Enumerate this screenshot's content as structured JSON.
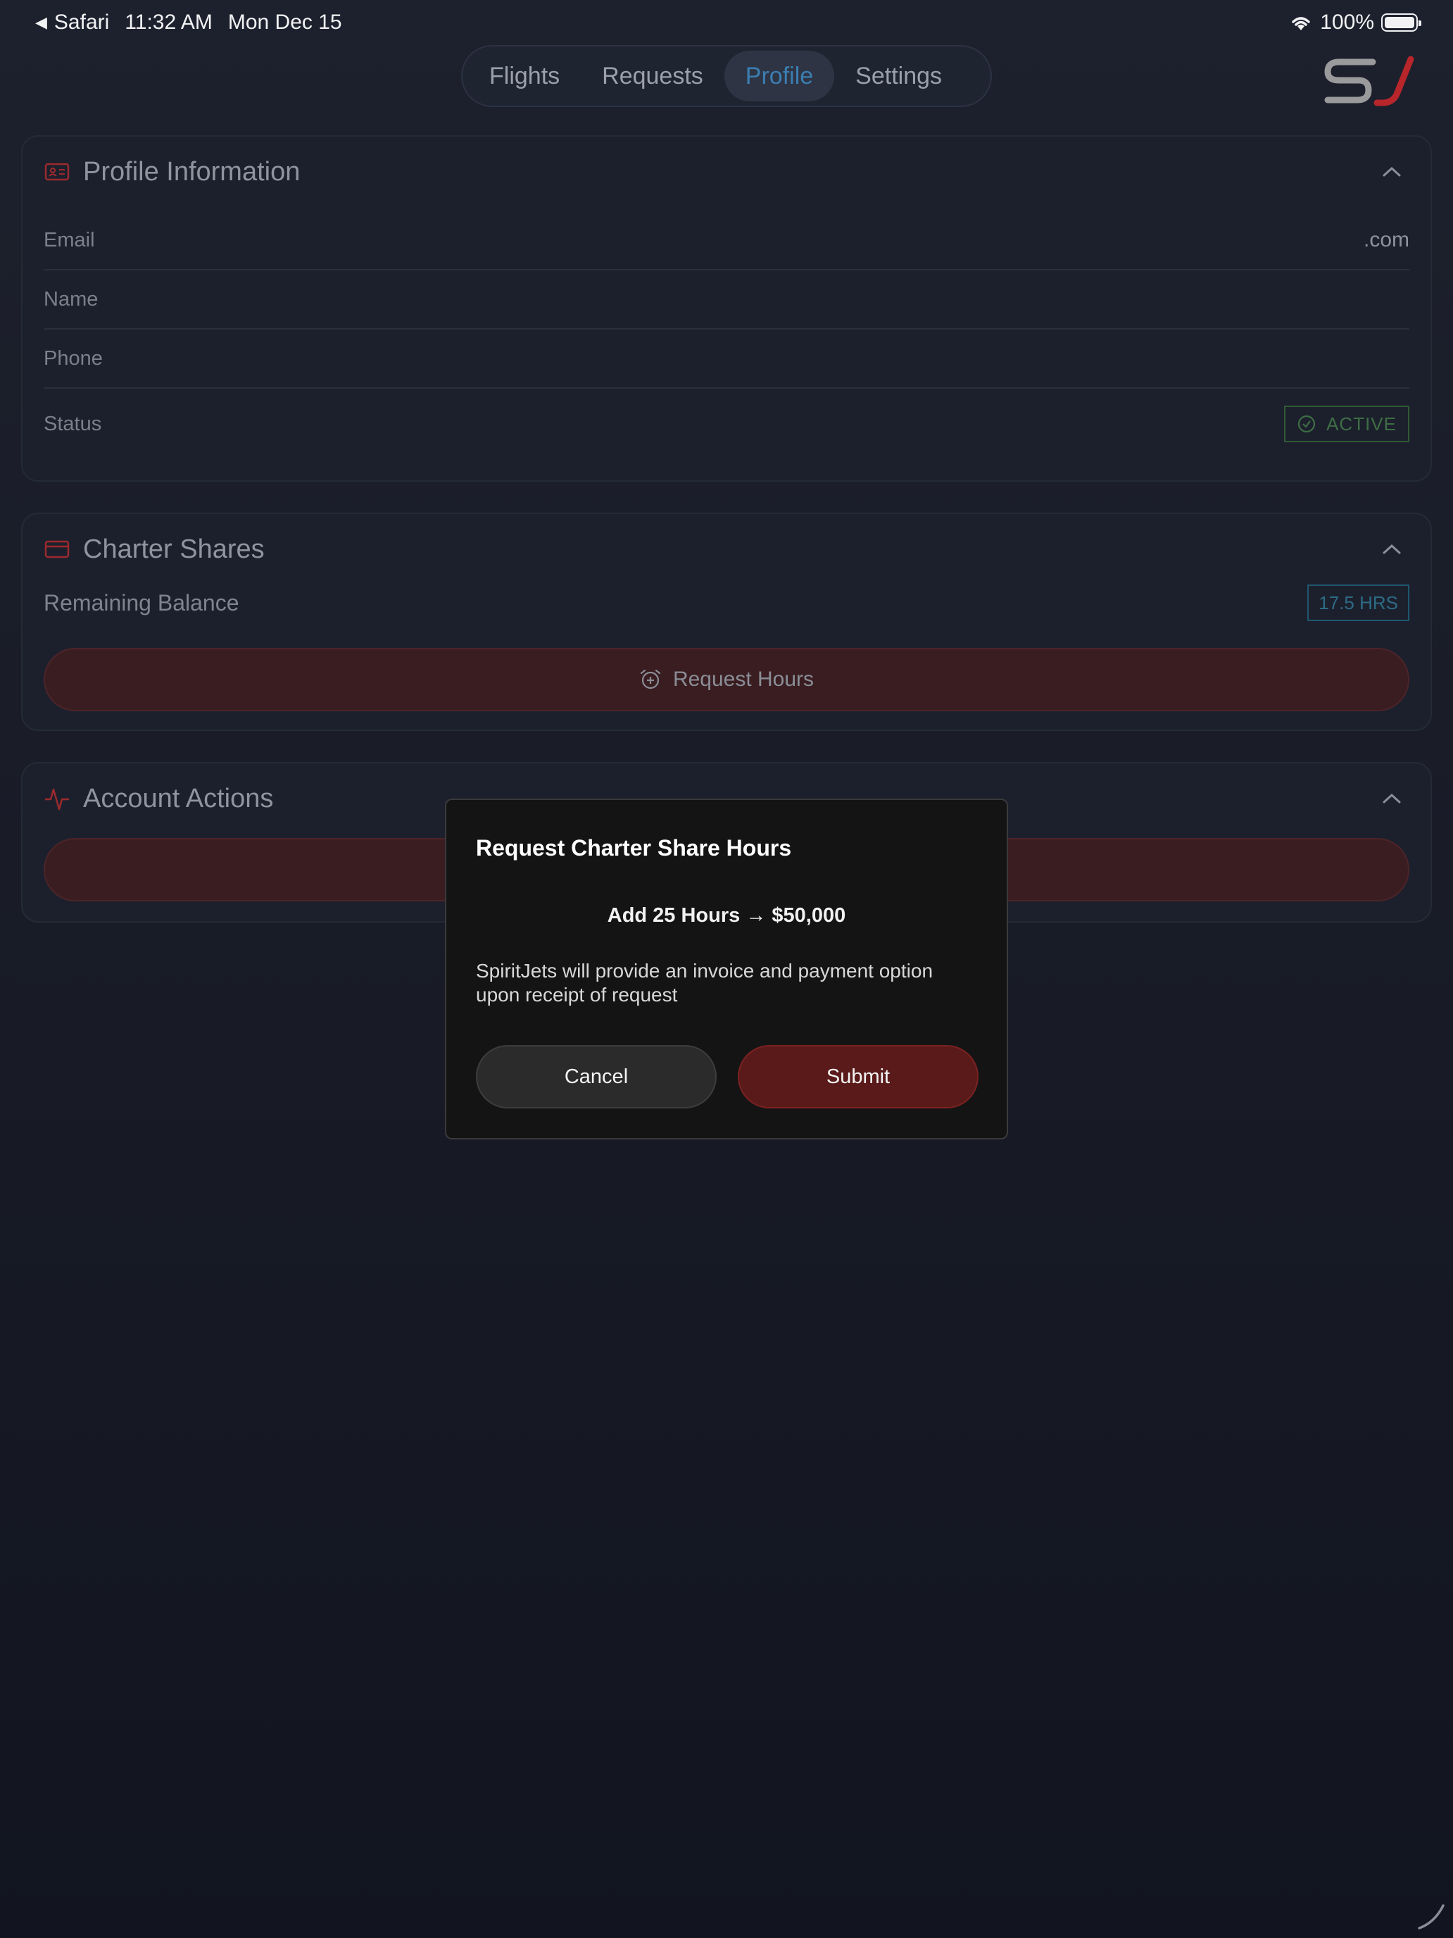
{
  "status_bar": {
    "app": "Safari",
    "time": "11:32 AM",
    "date": "Mon Dec 15",
    "battery": "100%"
  },
  "nav": {
    "tabs": [
      {
        "label": "Flights"
      },
      {
        "label": "Requests"
      },
      {
        "label": "Profile"
      },
      {
        "label": "Settings"
      }
    ],
    "active": "Profile"
  },
  "logo_text": "SJ",
  "profile": {
    "title": "Profile Information",
    "email_label": "Email",
    "email_value": ".com",
    "name_label": "Name",
    "phone_label": "Phone",
    "status_label": "Status",
    "status_value": "ACTIVE"
  },
  "charter": {
    "title": "Charter Shares",
    "balance_label": "Remaining Balance",
    "balance_value": "17.5 HRS",
    "request_button": "Request Hours"
  },
  "account": {
    "title": "Account Actions"
  },
  "modal": {
    "title": "Request Charter Share Hours",
    "offer": "Add 25 Hours → $50,000",
    "description": "SpiritJets will provide an invoice and payment option upon receipt of request",
    "cancel": "Cancel",
    "submit": "Submit"
  },
  "colors": {
    "accent_red": "#c0262d",
    "active_tab_blue": "#3b7eb2",
    "status_green": "#3e6d45",
    "submit_bg": "#5a1a1a"
  }
}
